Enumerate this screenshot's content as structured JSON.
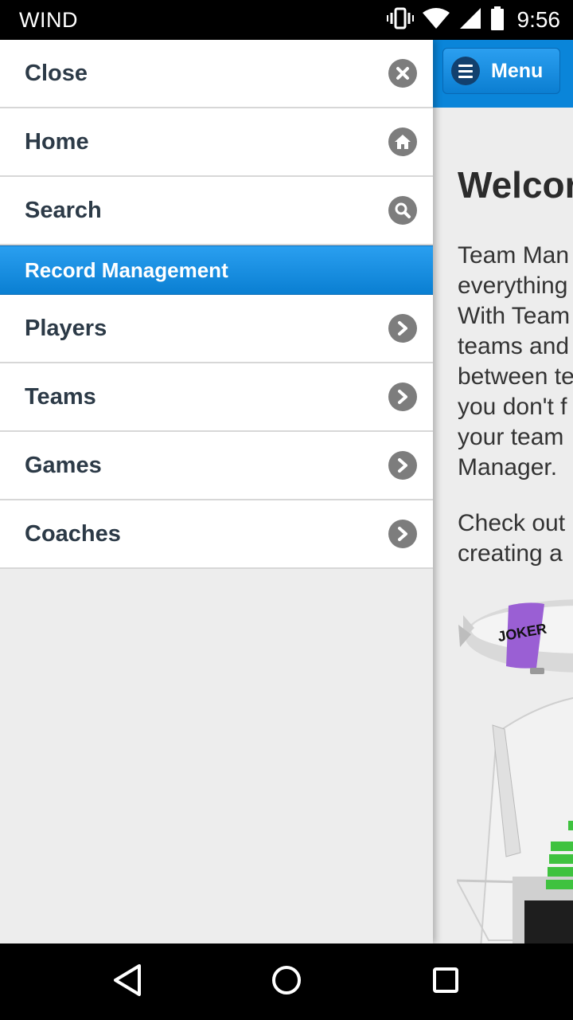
{
  "status_bar": {
    "carrier": "WIND",
    "time": "9:56"
  },
  "header": {
    "menu_label": "Menu"
  },
  "drawer": {
    "close": {
      "label": "Close",
      "icon": "close-icon"
    },
    "top_items": [
      {
        "label": "Home",
        "icon": "home-icon"
      },
      {
        "label": "Search",
        "icon": "search-icon"
      }
    ],
    "section_label": "Record Management",
    "record_items": [
      {
        "label": "Players",
        "icon": "chevron-right-icon"
      },
      {
        "label": "Teams",
        "icon": "chevron-right-icon"
      },
      {
        "label": "Games",
        "icon": "chevron-right-icon"
      },
      {
        "label": "Coaches",
        "icon": "chevron-right-icon"
      }
    ]
  },
  "content": {
    "title": "Welcor",
    "paragraph1": [
      "Team Man",
      "everything",
      "With Team",
      "teams and",
      "between te",
      "you don't f",
      "your team",
      "Manager."
    ],
    "paragraph2": [
      "Check out",
      "creating a"
    ],
    "blimp_text": "JOKER"
  },
  "colors": {
    "accent": "#0a85d9",
    "drawer_text": "#2c3a47",
    "icon_gray": "#7d7d7d"
  }
}
